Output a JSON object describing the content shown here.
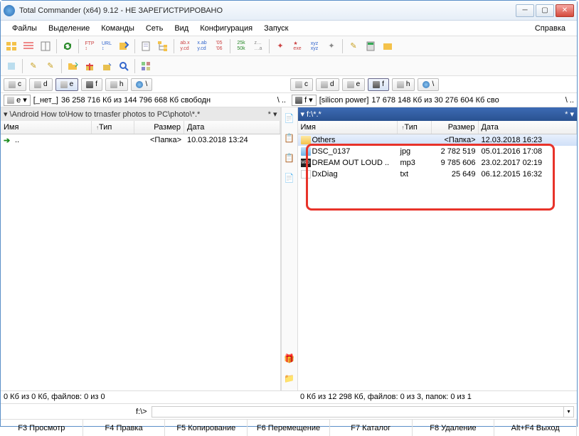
{
  "window": {
    "title": "Total Commander (x64) 9.12 - НЕ ЗАРЕГИСТРИРОВАНО"
  },
  "menu": {
    "items": [
      "Файлы",
      "Выделение",
      "Команды",
      "Сеть",
      "Вид",
      "Конфигурация",
      "Запуск"
    ],
    "help": "Справка"
  },
  "drives": {
    "left": [
      {
        "letter": "c",
        "type": "disk",
        "sel": false
      },
      {
        "letter": "d",
        "type": "disk",
        "sel": false
      },
      {
        "letter": "e",
        "type": "disk",
        "sel": true
      },
      {
        "letter": "f",
        "type": "hdd",
        "sel": false
      },
      {
        "letter": "h",
        "type": "disk",
        "sel": false
      }
    ],
    "right": [
      {
        "letter": "c",
        "type": "disk",
        "sel": false
      },
      {
        "letter": "d",
        "type": "disk",
        "sel": false
      },
      {
        "letter": "e",
        "type": "disk",
        "sel": false
      },
      {
        "letter": "f",
        "type": "hdd",
        "sel": true
      },
      {
        "letter": "h",
        "type": "disk",
        "sel": false
      }
    ]
  },
  "info": {
    "left": {
      "drive": "e",
      "label": "[_нет_]",
      "space": "36 258 716 Кб из 144 796 668 Кб свободн",
      "nav": "\\  .."
    },
    "right": {
      "drive": "f",
      "label": "[silicon power]",
      "space": "17 678 148 Кб из 30 276 604 Кб сво",
      "nav": "\\  .."
    }
  },
  "tabs": {
    "left": "\\Android How to\\How to trnasfer photos to PC\\photo\\*.*",
    "right": "f:\\*.*"
  },
  "columns": {
    "name": "Имя",
    "type": "Тип",
    "size": "Размер",
    "date": "Дата"
  },
  "left_files": [
    {
      "icon": "up",
      "name": "..",
      "type": "",
      "size": "<Папка>",
      "date": "10.03.2018 13:24"
    }
  ],
  "right_files": [
    {
      "icon": "folder",
      "name": "Others",
      "type": "",
      "size": "<Папка>",
      "date": "12.03.2018 16:23",
      "sel": true
    },
    {
      "icon": "img",
      "name": "DSC_0137",
      "type": "jpg",
      "size": "2 782 519",
      "date": "05.01.2016 17:08"
    },
    {
      "icon": "mp3",
      "name": "DREAM OUT LOUD ..",
      "type": "mp3",
      "size": "9 785 606",
      "date": "23.02.2017 02:19"
    },
    {
      "icon": "txt",
      "name": "DxDiag",
      "type": "txt",
      "size": "25 649",
      "date": "06.12.2015 16:32"
    }
  ],
  "status": {
    "left": "0 Кб из 0 Кб, файлов: 0 из 0",
    "right": "0 Кб из 12 298 Кб, файлов: 0 из 3, папок: 0 из 1"
  },
  "cmdline": {
    "path": "f:\\>",
    "value": ""
  },
  "fkeys": [
    "F3 Просмотр",
    "F4 Правка",
    "F5 Копирование",
    "F6 Перемещение",
    "F7 Каталог",
    "F8 Удаление",
    "Alt+F4 Выход"
  ]
}
